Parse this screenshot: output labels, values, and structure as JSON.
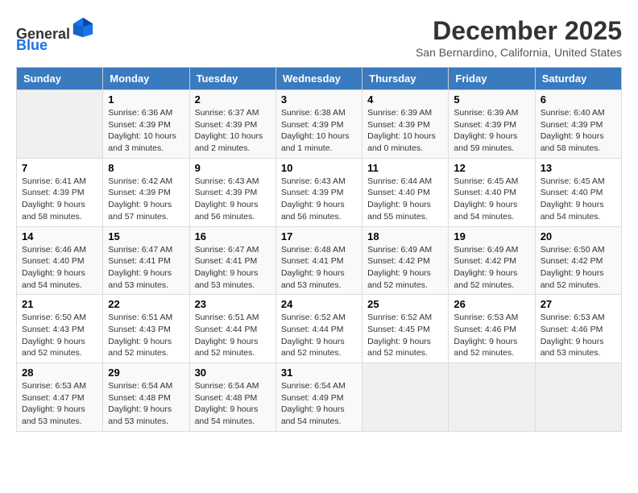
{
  "header": {
    "logo_line1": "General",
    "logo_line2": "Blue",
    "month_title": "December 2025",
    "location": "San Bernardino, California, United States"
  },
  "days_of_week": [
    "Sunday",
    "Monday",
    "Tuesday",
    "Wednesday",
    "Thursday",
    "Friday",
    "Saturday"
  ],
  "weeks": [
    [
      {
        "day": "",
        "info": ""
      },
      {
        "day": "1",
        "info": "Sunrise: 6:36 AM\nSunset: 4:39 PM\nDaylight: 10 hours\nand 3 minutes."
      },
      {
        "day": "2",
        "info": "Sunrise: 6:37 AM\nSunset: 4:39 PM\nDaylight: 10 hours\nand 2 minutes."
      },
      {
        "day": "3",
        "info": "Sunrise: 6:38 AM\nSunset: 4:39 PM\nDaylight: 10 hours\nand 1 minute."
      },
      {
        "day": "4",
        "info": "Sunrise: 6:39 AM\nSunset: 4:39 PM\nDaylight: 10 hours\nand 0 minutes."
      },
      {
        "day": "5",
        "info": "Sunrise: 6:39 AM\nSunset: 4:39 PM\nDaylight: 9 hours\nand 59 minutes."
      },
      {
        "day": "6",
        "info": "Sunrise: 6:40 AM\nSunset: 4:39 PM\nDaylight: 9 hours\nand 58 minutes."
      }
    ],
    [
      {
        "day": "7",
        "info": "Sunrise: 6:41 AM\nSunset: 4:39 PM\nDaylight: 9 hours\nand 58 minutes."
      },
      {
        "day": "8",
        "info": "Sunrise: 6:42 AM\nSunset: 4:39 PM\nDaylight: 9 hours\nand 57 minutes."
      },
      {
        "day": "9",
        "info": "Sunrise: 6:43 AM\nSunset: 4:39 PM\nDaylight: 9 hours\nand 56 minutes."
      },
      {
        "day": "10",
        "info": "Sunrise: 6:43 AM\nSunset: 4:39 PM\nDaylight: 9 hours\nand 56 minutes."
      },
      {
        "day": "11",
        "info": "Sunrise: 6:44 AM\nSunset: 4:40 PM\nDaylight: 9 hours\nand 55 minutes."
      },
      {
        "day": "12",
        "info": "Sunrise: 6:45 AM\nSunset: 4:40 PM\nDaylight: 9 hours\nand 54 minutes."
      },
      {
        "day": "13",
        "info": "Sunrise: 6:45 AM\nSunset: 4:40 PM\nDaylight: 9 hours\nand 54 minutes."
      }
    ],
    [
      {
        "day": "14",
        "info": "Sunrise: 6:46 AM\nSunset: 4:40 PM\nDaylight: 9 hours\nand 54 minutes."
      },
      {
        "day": "15",
        "info": "Sunrise: 6:47 AM\nSunset: 4:41 PM\nDaylight: 9 hours\nand 53 minutes."
      },
      {
        "day": "16",
        "info": "Sunrise: 6:47 AM\nSunset: 4:41 PM\nDaylight: 9 hours\nand 53 minutes."
      },
      {
        "day": "17",
        "info": "Sunrise: 6:48 AM\nSunset: 4:41 PM\nDaylight: 9 hours\nand 53 minutes."
      },
      {
        "day": "18",
        "info": "Sunrise: 6:49 AM\nSunset: 4:42 PM\nDaylight: 9 hours\nand 52 minutes."
      },
      {
        "day": "19",
        "info": "Sunrise: 6:49 AM\nSunset: 4:42 PM\nDaylight: 9 hours\nand 52 minutes."
      },
      {
        "day": "20",
        "info": "Sunrise: 6:50 AM\nSunset: 4:42 PM\nDaylight: 9 hours\nand 52 minutes."
      }
    ],
    [
      {
        "day": "21",
        "info": "Sunrise: 6:50 AM\nSunset: 4:43 PM\nDaylight: 9 hours\nand 52 minutes."
      },
      {
        "day": "22",
        "info": "Sunrise: 6:51 AM\nSunset: 4:43 PM\nDaylight: 9 hours\nand 52 minutes."
      },
      {
        "day": "23",
        "info": "Sunrise: 6:51 AM\nSunset: 4:44 PM\nDaylight: 9 hours\nand 52 minutes."
      },
      {
        "day": "24",
        "info": "Sunrise: 6:52 AM\nSunset: 4:44 PM\nDaylight: 9 hours\nand 52 minutes."
      },
      {
        "day": "25",
        "info": "Sunrise: 6:52 AM\nSunset: 4:45 PM\nDaylight: 9 hours\nand 52 minutes."
      },
      {
        "day": "26",
        "info": "Sunrise: 6:53 AM\nSunset: 4:46 PM\nDaylight: 9 hours\nand 52 minutes."
      },
      {
        "day": "27",
        "info": "Sunrise: 6:53 AM\nSunset: 4:46 PM\nDaylight: 9 hours\nand 53 minutes."
      }
    ],
    [
      {
        "day": "28",
        "info": "Sunrise: 6:53 AM\nSunset: 4:47 PM\nDaylight: 9 hours\nand 53 minutes."
      },
      {
        "day": "29",
        "info": "Sunrise: 6:54 AM\nSunset: 4:48 PM\nDaylight: 9 hours\nand 53 minutes."
      },
      {
        "day": "30",
        "info": "Sunrise: 6:54 AM\nSunset: 4:48 PM\nDaylight: 9 hours\nand 54 minutes."
      },
      {
        "day": "31",
        "info": "Sunrise: 6:54 AM\nSunset: 4:49 PM\nDaylight: 9 hours\nand 54 minutes."
      },
      {
        "day": "",
        "info": ""
      },
      {
        "day": "",
        "info": ""
      },
      {
        "day": "",
        "info": ""
      }
    ]
  ]
}
